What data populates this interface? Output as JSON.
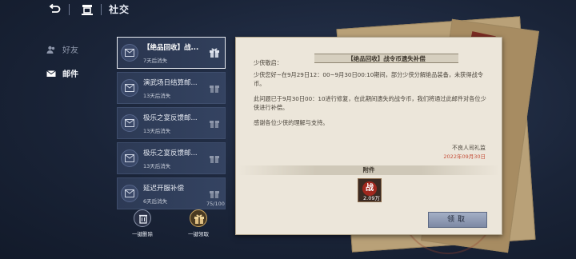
{
  "topbar": {
    "title": "社交",
    "back_icon": "back-arrow-icon",
    "home_icon": "home-icon"
  },
  "nav": {
    "items": [
      {
        "label": "好友",
        "icon": "friends-icon",
        "active": false
      },
      {
        "label": "邮件",
        "icon": "mail-icon",
        "active": true
      }
    ]
  },
  "mails": [
    {
      "subject": "【绝品回收】战...",
      "expire": "7天后消失",
      "active": true
    },
    {
      "subject": "演武场日结算邮...",
      "expire": "13天后消失",
      "active": false
    },
    {
      "subject": "极乐之宴反馈邮...",
      "expire": "13天后消失",
      "active": false
    },
    {
      "subject": "极乐之宴反馈邮...",
      "expire": "13天后消失",
      "active": false
    },
    {
      "subject": "延迟开服补偿",
      "expire": "6天后消失",
      "active": false
    }
  ],
  "counter": "75/100",
  "actions": {
    "delete_label": "一键删除",
    "claim_all_label": "一键领取"
  },
  "letter": {
    "title": "【绝品回收】战令币遗失补偿",
    "greeting": "少侠敬启：",
    "paragraphs": [
      "少侠您好~在9月29日12：00~9月30日00:10期间，部分少侠分解绝品装备，未获得战令币。",
      "此问题已于9月30日00：10进行修复，在此期间遗失的战令币，我们将通过此邮件对各位少侠进行补偿。",
      "感谢各位少侠的理解与支持。"
    ],
    "signature": "不良人司礼监",
    "date": "2022年09月30日",
    "attachment_header": "附件",
    "attachment": {
      "glyph": "战",
      "quantity": "2.09万"
    },
    "claim_label": "领取"
  },
  "colors": {
    "bg": "#1a2438",
    "paper": "#ece6da",
    "date_red": "#c5513c",
    "claim_gold": "#c9a45e"
  }
}
